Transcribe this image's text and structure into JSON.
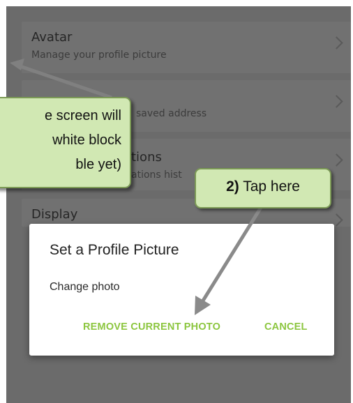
{
  "settings": {
    "rows": [
      {
        "title": "Avatar",
        "subtitle": "Manage your profile picture"
      },
      {
        "title": "",
        "subtitle": "saved address"
      },
      {
        "title": "tions",
        "subtitle": "ations hist"
      },
      {
        "title": "Display",
        "subtitle": ""
      }
    ]
  },
  "dialog": {
    "title": "Set a Profile Picture",
    "option": "Change photo",
    "remove_button": "REMOVE CURRENT PHOTO",
    "cancel_button": "CANCEL",
    "accent_color": "#8cc63f"
  },
  "annotations": {
    "callout_left": [
      "e screen will",
      "white block",
      "ble yet)"
    ],
    "callout_right_step": "2)",
    "callout_right_text": " Tap here",
    "callout_fill": "#d1e8b3"
  },
  "icons": {
    "row_chevron": "chevron-right-icon",
    "arrow": "arrow-icon"
  }
}
